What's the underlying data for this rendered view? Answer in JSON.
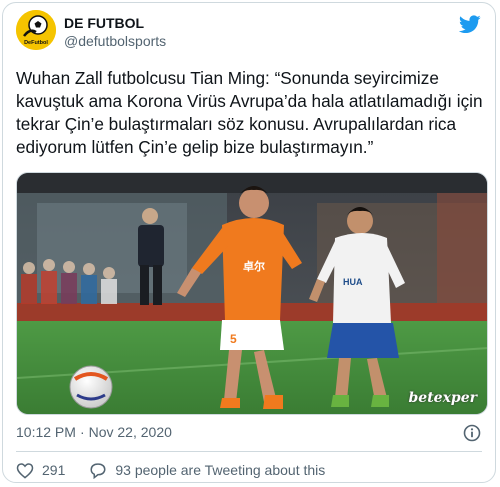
{
  "account": {
    "display_name": "DE FUTBOL",
    "handle": "@defutbolsports",
    "avatar_text": "DeFutbol"
  },
  "tweet": {
    "text": "Wuhan Zall futbolcusu Tian Ming: “Sonunda seyircimize\nkavuştuk ama Korona Virüs Avrupa’da hala atlatılamadığı için\ntekrar Çin’e bulaştırmaları söz konusu. Avrupalılardan rica\nediyorum lütfen Çin’e gelip bize bulaştırmayın.”"
  },
  "media": {
    "jersey_text": "卓尔",
    "jersey_number": "5",
    "white_jersey_text": "HUA",
    "watermark": "betexper"
  },
  "meta": {
    "time": "10:12 PM",
    "separator": "·",
    "date": "Nov 22, 2020"
  },
  "actions": {
    "likes": "291",
    "tweeting": "93 people are Tweeting about this"
  },
  "colors": {
    "twitter_blue": "#1d9bf0",
    "avatar_yellow": "#f5c400",
    "orange_kit": "#f07a1e",
    "pitch_green": "#3f8a3a"
  },
  "icons": {
    "logo": "twitter-bird-icon",
    "info": "info-icon",
    "like": "heart-icon",
    "reply": "speech-bubble-icon"
  }
}
